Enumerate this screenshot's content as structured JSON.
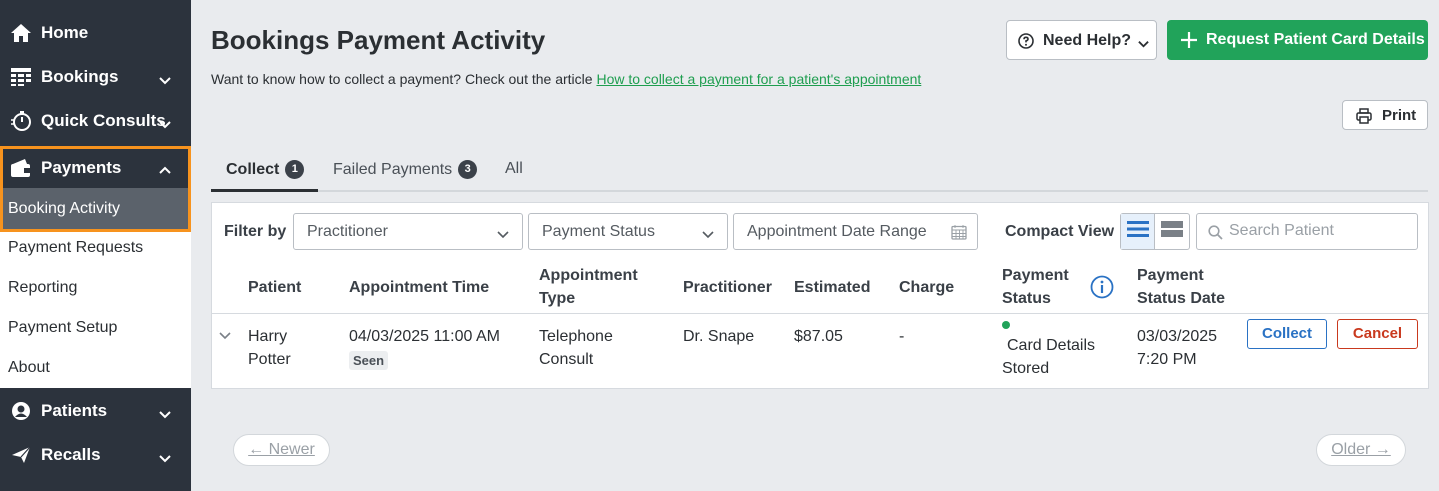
{
  "sidebar": {
    "items": [
      {
        "label": "Home",
        "icon": "home-icon"
      },
      {
        "label": "Bookings",
        "icon": "calendar-grid-icon"
      },
      {
        "label": "Quick Consults",
        "icon": "stopwatch-icon"
      },
      {
        "label": "Payments",
        "icon": "wallet-icon"
      },
      {
        "label": "Patients",
        "icon": "person-circle-icon"
      },
      {
        "label": "Recalls",
        "icon": "paper-plane-icon"
      }
    ],
    "payments_sub": {
      "active": "Booking Activity",
      "items": [
        "Payment Requests",
        "Reporting",
        "Payment Setup",
        "About"
      ]
    }
  },
  "header": {
    "title": "Bookings Payment Activity",
    "subtitle_prefix": "Want to know how to collect a payment? Check out the article ",
    "subtitle_link": "How to collect a payment for a patient's appointment",
    "help_label": "Need Help?",
    "request_label": "Request Patient Card Details",
    "print_label": "Print"
  },
  "tabs": [
    {
      "label": "Collect",
      "count": "1"
    },
    {
      "label": "Failed Payments",
      "count": "3"
    },
    {
      "label": "All",
      "count": ""
    }
  ],
  "filters": {
    "label": "Filter by",
    "practitioner": "Practitioner",
    "payment_status": "Payment Status",
    "date_range": "Appointment Date Range",
    "compact_view": "Compact View",
    "search_placeholder": "Search Patient"
  },
  "table": {
    "columns": {
      "patient": "Patient",
      "appointment_time": "Appointment Time",
      "appointment_type_1": "Appointment",
      "appointment_type_2": "Type",
      "practitioner": "Practitioner",
      "estimated": "Estimated",
      "charge": "Charge",
      "payment_status_1": "Payment",
      "payment_status_2": "Status",
      "status_date_1": "Payment",
      "status_date_2": "Status Date"
    },
    "rows": [
      {
        "patient_1": "Harry",
        "patient_2": "Potter",
        "appointment_time": "04/03/2025 11:00 AM",
        "appointment_state": "Seen",
        "type_1": "Telephone",
        "type_2": "Consult",
        "practitioner": "Dr. Snape",
        "estimated": "$87.05",
        "charge": "-",
        "status_1": "Card Details",
        "status_2": "Stored",
        "status_date_1": "03/03/2025",
        "status_date_2": "7:20 PM",
        "collect_label": "Collect",
        "cancel_label": "Cancel"
      }
    ]
  },
  "pagination": {
    "newer": "← Newer",
    "older": "Older →"
  },
  "colors": {
    "sidebar_bg": "#2c333d",
    "accent_green": "#21a35a",
    "highlight_orange": "#f7931e",
    "collect_blue": "#2a72c4",
    "cancel_red": "#c9391e"
  }
}
